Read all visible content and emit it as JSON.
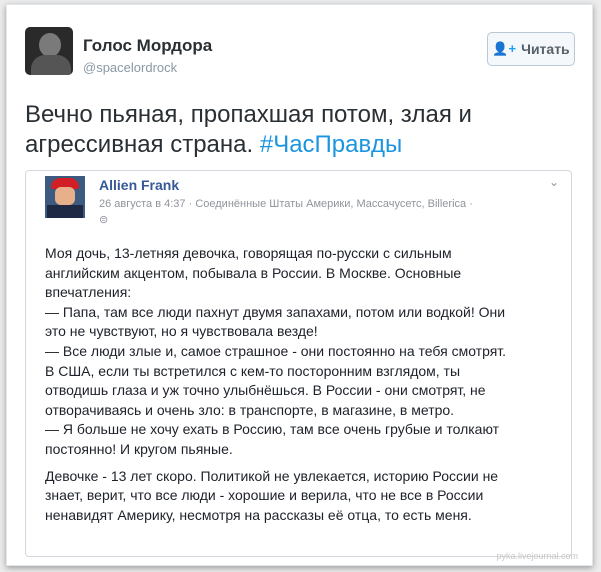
{
  "tweet": {
    "author_name": "Голос Мордора",
    "author_handle": "@spacelordrock",
    "follow_label": "Читать",
    "text": "Вечно пьяная, пропахшая потом, злая и агрессивная страна.",
    "hashtag": "#ЧасПравды"
  },
  "embedded_post": {
    "author_name": "Allien Frank",
    "meta": "26 августа в 4:37 · Соединённые Штаты Америки, Массачусетс, Billerica ·",
    "globe_icon": "globe-icon",
    "lines": [
      "Моя дочь, 13-летняя девочка, говорящая по-русски с сильным",
      "английским акцентом, побывала в России. В Москве. Основные",
      "впечатления:",
      "— Папа, там все люди пахнут двумя запахами, потом или водкой! Они",
      "это не чувствуют, но я чувствовала везде!",
      "— Все люди злые и, самое страшное - они постоянно на тебя смотрят.",
      "В США, если ты встретился с кем-то посторонним взглядом, ты",
      "отводишь глаза и уж точно улыбнёшься. В России - они смотрят, не",
      "отворачиваясь и очень зло: в транспорте, в магазине, в метро.",
      "— Я больше не хочу ехать в Россию, там все очень грубые и толкают",
      "постоянно! И кругом пьяные."
    ],
    "lines2": [
      "Девочке - 13 лет скоро. Политикой не увлекается, историю России не",
      "знает, верит, что все люди - хорошие и верила, что не все в России",
      "ненавидят Америку, несмотря на рассказы её отца, то есть меня."
    ]
  },
  "watermark": "pyka.livejournal.com",
  "colors": {
    "hashtag": "#1b95e0",
    "fb_name": "#365899",
    "follow_icon": "#1da1f2"
  }
}
